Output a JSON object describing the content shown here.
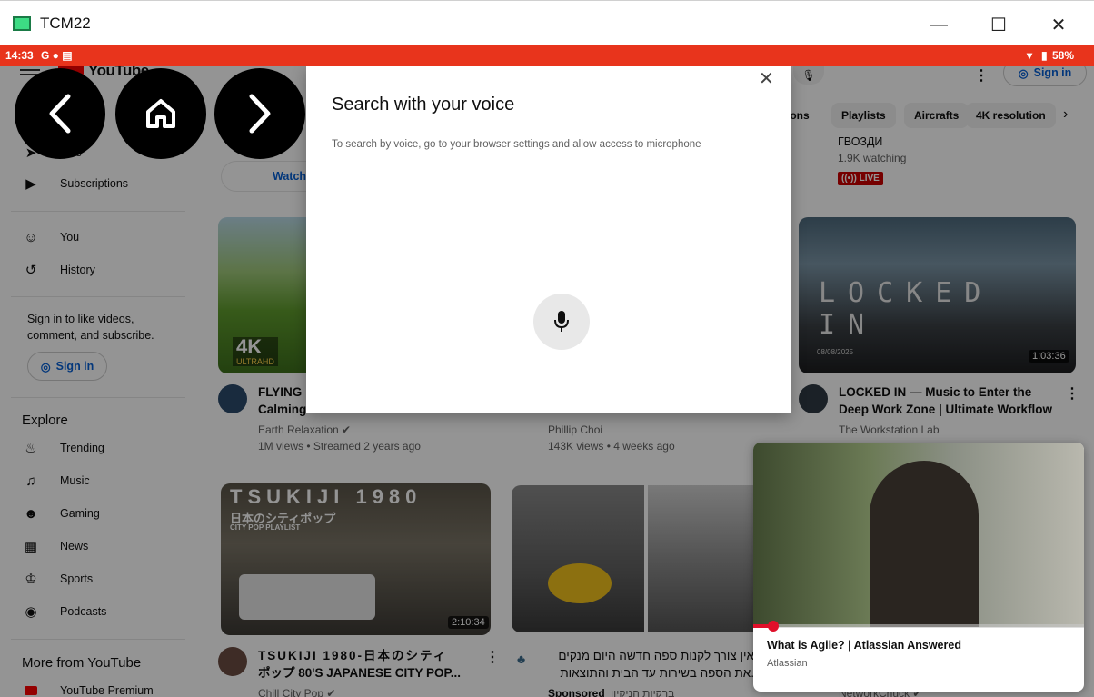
{
  "window": {
    "title": "TCM22",
    "minimize": "—",
    "maximize": "☐",
    "close": "✕"
  },
  "status": {
    "time": "14:33",
    "left_icons": "G ● ▤",
    "battery": "58%"
  },
  "header": {
    "logo": "YouTube",
    "sign_in": "Sign in"
  },
  "chips": [
    "ions",
    "Playlists",
    "Aircrafts",
    "4K resolution"
  ],
  "sidebar": {
    "partial_shorts": "ts",
    "subscriptions": "Subscriptions",
    "you": "You",
    "history": "History",
    "signin_prompt": "Sign in to like videos, comment, and subscribe.",
    "signin_button": "Sign in",
    "explore_heading": "Explore",
    "explore": [
      "Trending",
      "Music",
      "Gaming",
      "News",
      "Sports",
      "Podcasts"
    ],
    "more_heading": "More from YouTube",
    "premium": "YouTube Premium"
  },
  "top_partial": {
    "watch_label": "Watch",
    "channel_name": "ГВОЗДИ",
    "watching": "1.9K watching",
    "live": "((•)) LIVE"
  },
  "videos": {
    "v1": {
      "title_line1": "FLYING",
      "title_line2": "Calming",
      "channel": "Earth Relaxation ✔",
      "meta": "1M views • Streamed 2 years ago",
      "badge_main": "4K",
      "badge_sub": "ULTRAHD"
    },
    "v2": {
      "channel": "Phillip Choi",
      "meta": "143K views • 4 weeks ago"
    },
    "v3": {
      "title_line1": "LOCKED IN — Music to Enter the",
      "title_line2": "Deep Work Zone | Ultimate Workflow",
      "channel": "The Workstation Lab",
      "duration": "1:03:36",
      "overlay": "LOCKED IN",
      "date_overlay": "08/08/2025"
    },
    "v4": {
      "title_line1": "TSUKIJI 1980-日本のシティ",
      "title_line2": "ポップ 80'S JAPANESE CITY POP...",
      "channel": "Chill City Pop ✔",
      "duration": "2:10:34",
      "thumb_title": "TSUKIJI 1980",
      "thumb_sub1": "日本のシティポップ",
      "thumb_sub2": "CITY POP PLAYLIST"
    },
    "v5": {
      "title_line1": "אין צורך לקנות ספה חדשה היום מנקים",
      "title_line2": ".את הספה בשירות עד הבית והתוצאות",
      "sponsored": "Sponsored",
      "sponsor_name": "ברקיות הניקיון"
    },
    "v6": {
      "channel": "NetworkChuck ✔"
    }
  },
  "dialog": {
    "title": "Search with your voice",
    "description": "To search by voice, go to your browser settings and allow access to microphone",
    "close": "✕"
  },
  "mini_player": {
    "title": "What is Agile? | Atlassian Answered",
    "channel": "Atlassian",
    "progress": 0.06
  },
  "colors": {
    "status_bar": "#e8341c",
    "accent_red": "#ff0000",
    "link_blue": "#065fd4"
  }
}
